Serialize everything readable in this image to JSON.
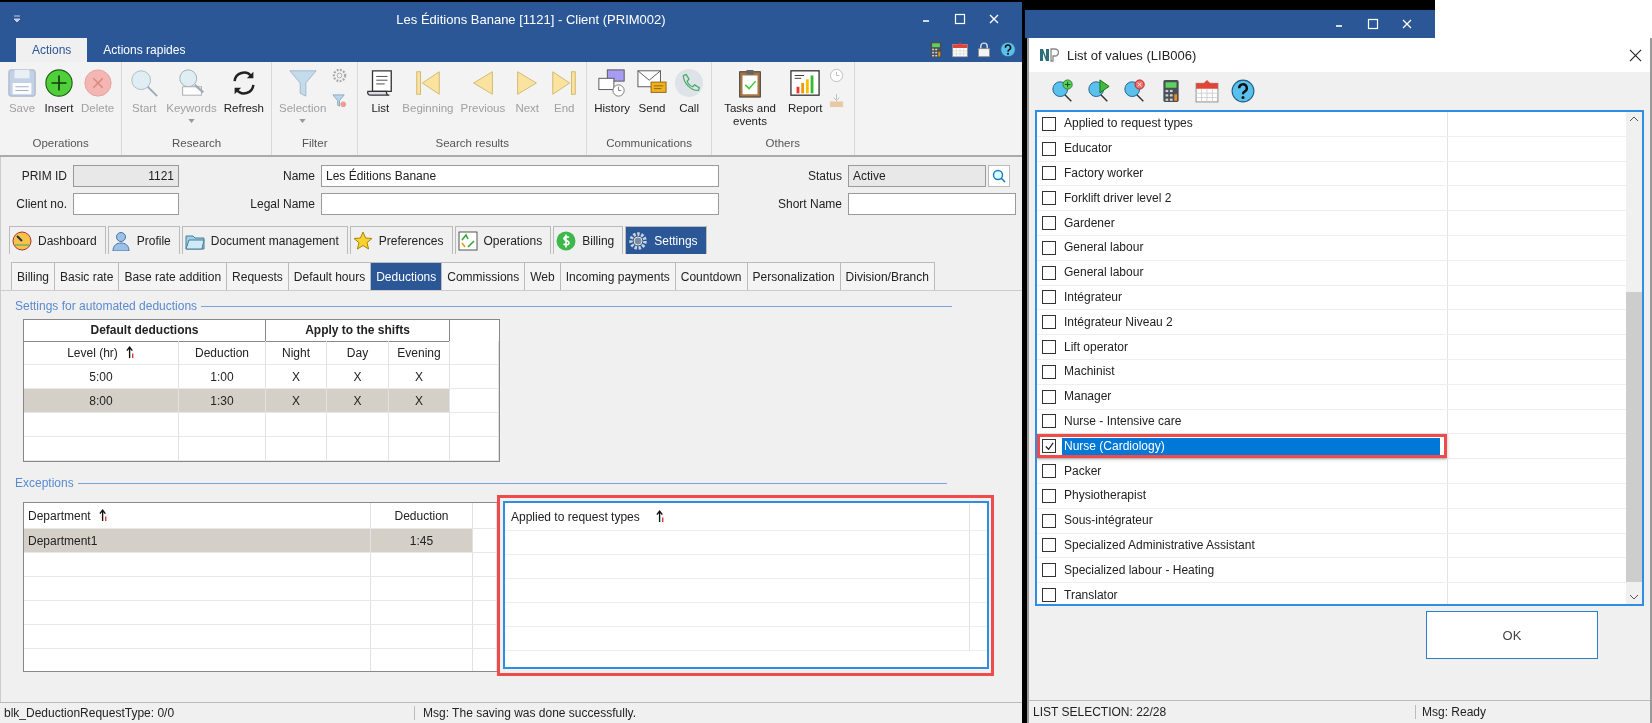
{
  "main_window": {
    "title": "Les Éditions Banane [1121] - Client (PRIM002)"
  },
  "ribbon_tabs": [
    {
      "label": "Actions",
      "selected": true
    },
    {
      "label": "Actions rapides",
      "selected": false
    }
  ],
  "ribbon_groups": [
    {
      "label": "Operations",
      "buttons": [
        {
          "label": "Save",
          "kind": "save",
          "disabled": true
        },
        {
          "label": "Insert",
          "kind": "insert",
          "disabled": false
        },
        {
          "label": "Delete",
          "kind": "delete",
          "disabled": true
        }
      ]
    },
    {
      "label": "Research",
      "buttons": [
        {
          "label": "Start",
          "kind": "search",
          "disabled": true
        },
        {
          "label": "Keywords",
          "kind": "keywords",
          "disabled": true,
          "dropdown": true
        },
        {
          "label": "Refresh",
          "kind": "refresh",
          "disabled": false
        }
      ]
    },
    {
      "label": "Filter",
      "buttons": [
        {
          "label": "Selection",
          "kind": "filter",
          "disabled": true,
          "dropdown": true
        }
      ],
      "side_icons": [
        {
          "kind": "gear"
        },
        {
          "kind": "filter-remove"
        }
      ]
    },
    {
      "label": "Search results",
      "buttons": [
        {
          "label": "List",
          "kind": "list",
          "disabled": false
        },
        {
          "label": "Beginning",
          "kind": "first",
          "disabled": true
        },
        {
          "label": "Previous",
          "kind": "previous",
          "disabled": true
        },
        {
          "label": "Next",
          "kind": "next",
          "disabled": true
        },
        {
          "label": "End",
          "kind": "last",
          "disabled": true
        }
      ]
    },
    {
      "label": "Communications",
      "buttons": [
        {
          "label": "History",
          "kind": "history",
          "disabled": false
        },
        {
          "label": "Send",
          "kind": "send",
          "disabled": false
        },
        {
          "label": "Call",
          "kind": "call",
          "disabled": false
        }
      ]
    },
    {
      "label": "Others",
      "buttons": [
        {
          "label": "Tasks and events",
          "kind": "tasks",
          "disabled": false
        },
        {
          "label": "Report",
          "kind": "report",
          "disabled": false
        }
      ],
      "side_icons": [
        {
          "kind": "clock"
        },
        {
          "kind": "tray"
        }
      ]
    }
  ],
  "form": {
    "prim_id": {
      "label": "PRIM ID",
      "value": "1121"
    },
    "name": {
      "label": "Name",
      "value": "Les Éditions Banane"
    },
    "status": {
      "label": "Status",
      "value": "Active"
    },
    "client_no": {
      "label": "Client no."
    },
    "legal_name": {
      "label": "Legal Name"
    },
    "short_name": {
      "label": "Short Name"
    }
  },
  "main_tabs": [
    {
      "label": "Dashboard",
      "kind": "dashboard",
      "selected": false
    },
    {
      "label": "Profile",
      "kind": "profile",
      "selected": false
    },
    {
      "label": "Document management",
      "kind": "documents",
      "selected": false
    },
    {
      "label": "Preferences",
      "kind": "preferences",
      "selected": false
    },
    {
      "label": "Operations",
      "kind": "operations",
      "selected": false
    },
    {
      "label": "Billing",
      "kind": "billing",
      "selected": false
    },
    {
      "label": "Settings",
      "kind": "settings",
      "selected": true
    }
  ],
  "sub_tabs": [
    {
      "label": "Billing",
      "selected": false
    },
    {
      "label": "Basic rate",
      "selected": false
    },
    {
      "label": "Base rate addition",
      "selected": false
    },
    {
      "label": "Requests",
      "selected": false
    },
    {
      "label": "Default hours",
      "selected": false
    },
    {
      "label": "Deductions",
      "selected": true
    },
    {
      "label": "Commissions",
      "selected": false
    },
    {
      "label": "Web",
      "selected": false
    },
    {
      "label": "Incoming payments",
      "selected": false
    },
    {
      "label": "Countdown",
      "selected": false
    },
    {
      "label": "Personalization",
      "selected": false
    },
    {
      "label": "Division/Branch",
      "selected": false
    }
  ],
  "deductions": {
    "title": "Settings for automated deductions",
    "group_headers": [
      "Default deductions",
      "Apply to the shifts"
    ],
    "columns": [
      {
        "label": "Level (hr)",
        "sorted": true
      },
      {
        "label": "Deduction",
        "sorted": false
      },
      {
        "label": "Night",
        "sorted": false
      },
      {
        "label": "Day",
        "sorted": false
      },
      {
        "label": "Evening",
        "sorted": false
      }
    ],
    "rows": [
      {
        "cells": [
          "5:00",
          "1:00",
          "X",
          "X",
          "X"
        ],
        "selected": false
      },
      {
        "cells": [
          "8:00",
          "1:30",
          "X",
          "X",
          "X"
        ],
        "selected": true
      }
    ]
  },
  "exceptions": {
    "title": "Exceptions",
    "columns": [
      {
        "label": "Department",
        "sorted": true
      },
      {
        "label": "Deduction",
        "sorted": false
      }
    ],
    "rows": [
      {
        "cells": [
          "Department1",
          "1:45"
        ],
        "selected": true
      }
    ],
    "request_types": {
      "column": {
        "label": "Applied to request types",
        "sorted": true
      },
      "highlighted": true
    }
  },
  "status_bar": {
    "block": "blk_DeductionRequestType: 0/0",
    "message": "Msg: The saving was done successfully."
  },
  "dialog": {
    "title": "List of values (LIB006)",
    "items": [
      {
        "label": "Applied to request types",
        "checked": false,
        "selected": false,
        "highlighted": false
      },
      {
        "label": "Educator",
        "checked": false,
        "selected": false,
        "highlighted": false
      },
      {
        "label": "Factory worker",
        "checked": false,
        "selected": false,
        "highlighted": false
      },
      {
        "label": "Forklift driver level 2",
        "checked": false,
        "selected": false,
        "highlighted": false
      },
      {
        "label": "Gardener",
        "checked": false,
        "selected": false,
        "highlighted": false
      },
      {
        "label": "General labour",
        "checked": false,
        "selected": false,
        "highlighted": false
      },
      {
        "label": "General labour",
        "checked": false,
        "selected": false,
        "highlighted": false
      },
      {
        "label": "Intégrateur",
        "checked": false,
        "selected": false,
        "highlighted": false
      },
      {
        "label": "Intégrateur Niveau 2",
        "checked": false,
        "selected": false,
        "highlighted": false
      },
      {
        "label": "Lift operator",
        "checked": false,
        "selected": false,
        "highlighted": false
      },
      {
        "label": "Machinist",
        "checked": false,
        "selected": false,
        "highlighted": false
      },
      {
        "label": "Manager",
        "checked": false,
        "selected": false,
        "highlighted": false
      },
      {
        "label": "Nurse - Intensive care",
        "checked": false,
        "selected": false,
        "highlighted": false
      },
      {
        "label": "Nurse (Cardiology)",
        "checked": true,
        "selected": true,
        "highlighted": true
      },
      {
        "label": "Packer",
        "checked": false,
        "selected": false,
        "highlighted": false
      },
      {
        "label": "Physiotherapist",
        "checked": false,
        "selected": false,
        "highlighted": false
      },
      {
        "label": "Sous-intégrateur",
        "checked": false,
        "selected": false,
        "highlighted": false
      },
      {
        "label": "Specialized Administrative Assistant",
        "checked": false,
        "selected": false,
        "highlighted": false
      },
      {
        "label": "Specialized labour - Heating",
        "checked": false,
        "selected": false,
        "highlighted": false
      },
      {
        "label": "Translator",
        "checked": false,
        "selected": false,
        "highlighted": false
      }
    ],
    "ok_button": "OK",
    "selection_status": "LIST SELECTION: 22/28",
    "message": "Msg: Ready"
  }
}
